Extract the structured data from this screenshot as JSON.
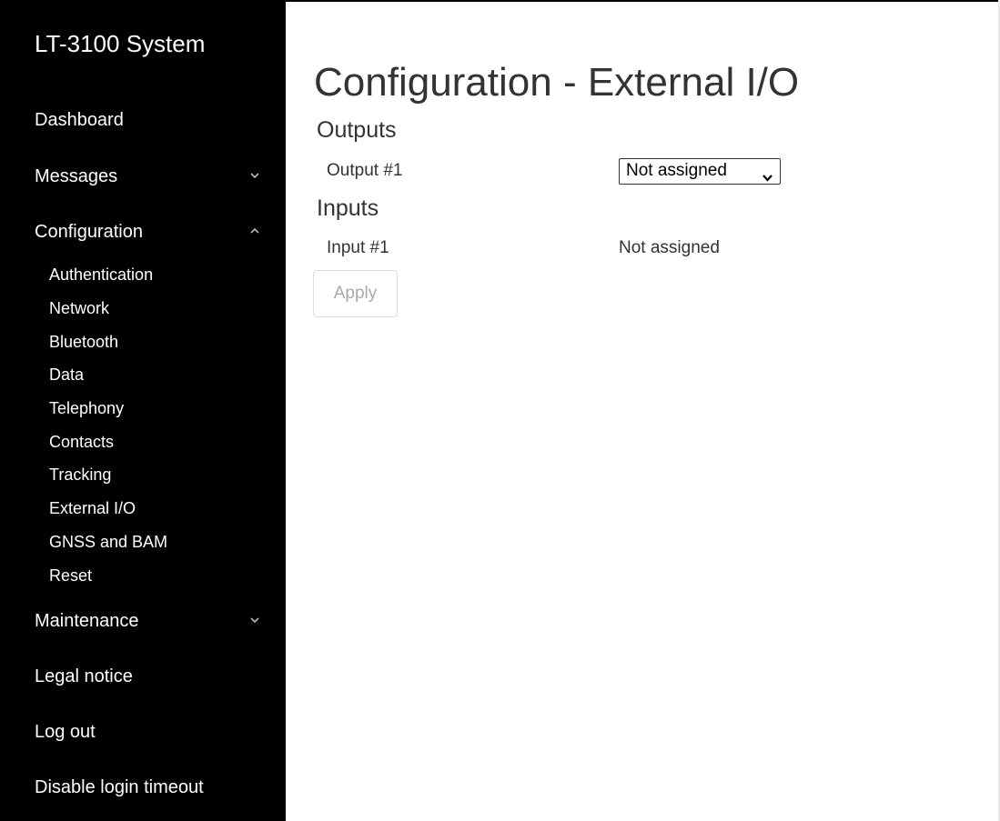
{
  "sidebar": {
    "brand": "LT-3100 System",
    "items": [
      {
        "label": "Dashboard"
      },
      {
        "label": "Messages",
        "chevron": "chevron-down-icon"
      },
      {
        "label": "Configuration",
        "chevron": "chevron-up-icon"
      },
      {
        "label": "Maintenance",
        "chevron": "chevron-down-icon"
      },
      {
        "label": "Legal notice"
      },
      {
        "label": "Log out"
      },
      {
        "label": "Disable login timeout"
      }
    ],
    "config_subitems": [
      "Authentication",
      "Network",
      "Bluetooth",
      "Data",
      "Telephony",
      "Contacts",
      "Tracking",
      "External I/O",
      "GNSS and BAM",
      "Reset"
    ]
  },
  "main": {
    "title": "Configuration - External I/O",
    "outputs": {
      "heading": "Outputs",
      "rows": [
        {
          "label": "Output #1",
          "value": "Not assigned"
        }
      ]
    },
    "inputs": {
      "heading": "Inputs",
      "rows": [
        {
          "label": "Input #1",
          "value": "Not assigned"
        }
      ]
    },
    "apply_label": "Apply"
  },
  "colors": {
    "sidebar_bg": "#000000",
    "sidebar_text": "#ffffff",
    "main_text": "#333333",
    "disabled_button_text": "#a9a9a9"
  }
}
